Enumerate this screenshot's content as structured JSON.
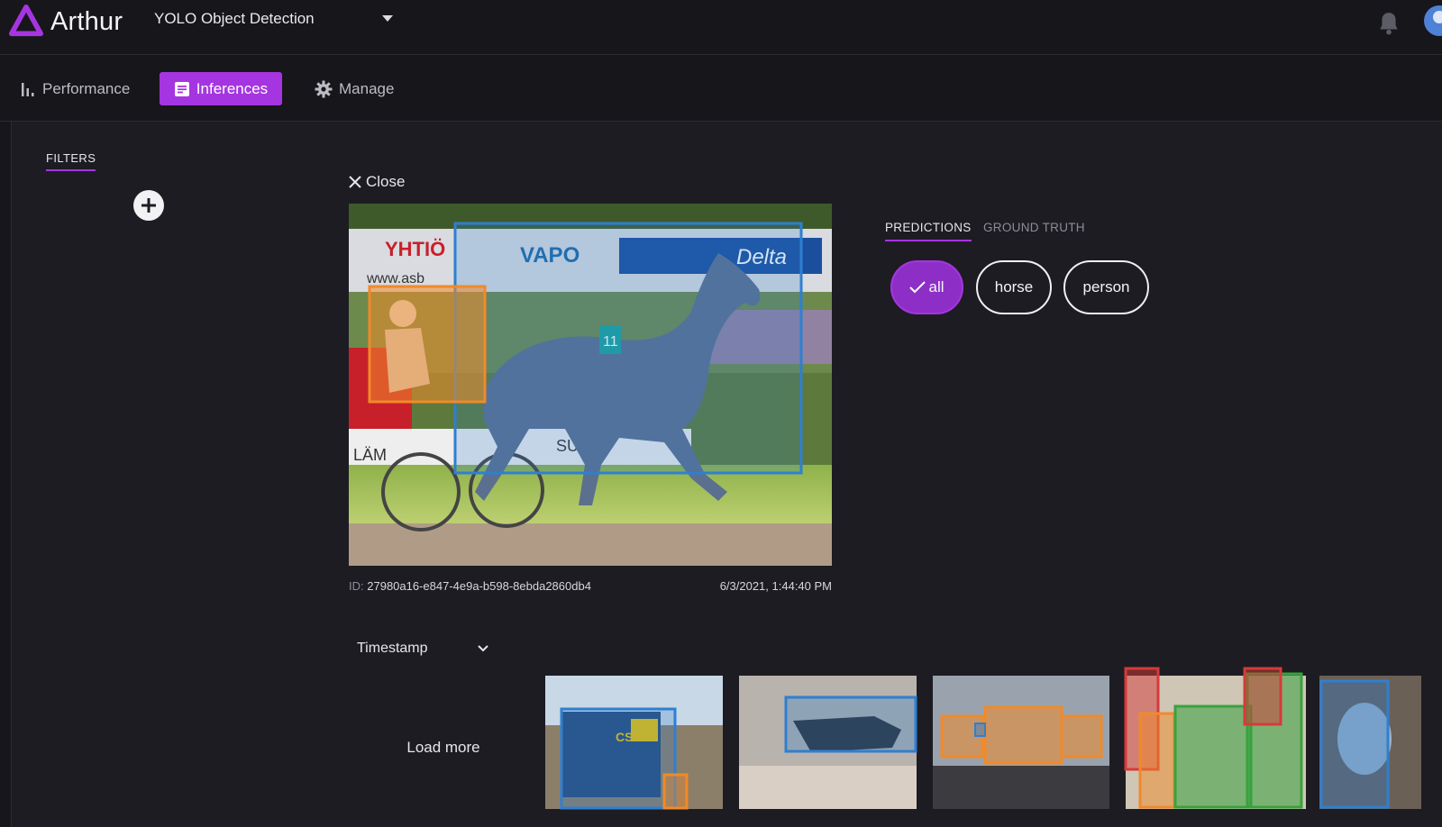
{
  "header": {
    "brand": "Arthur",
    "model_name": "YOLO Object Detection"
  },
  "nav": {
    "performance": "Performance",
    "inferences": "Inferences",
    "manage": "Manage"
  },
  "filters": {
    "label": "FILTERS"
  },
  "viewer": {
    "close_label": "Close",
    "id_label": "ID:",
    "id_value": "27980a16-e847-4e9a-b598-8ebda2860db4",
    "timestamp": "6/3/2021, 1:44:40 PM",
    "sign_text_1": "YHTIÖ",
    "sign_text_2": "www.asb",
    "sign_text_3": "VAPO",
    "sign_text_4": "Delta",
    "sign_text_5": "LÄM",
    "sign_text_6": "SUT",
    "sign_text_7": "11"
  },
  "predictions": {
    "tabs": [
      "PREDICTIONS",
      "GROUND TRUTH"
    ],
    "classes": [
      "all",
      "horse",
      "person"
    ],
    "selected": "all"
  },
  "gallery": {
    "sort_label": "Timestamp",
    "load_more": "Load more",
    "thumb1_text": "CSX"
  },
  "colors": {
    "accent": "#a535e0",
    "box_blue": "#2f7fd1",
    "box_orange": "#f08a2a",
    "box_red": "#d63a3a",
    "box_green": "#37a33d"
  }
}
